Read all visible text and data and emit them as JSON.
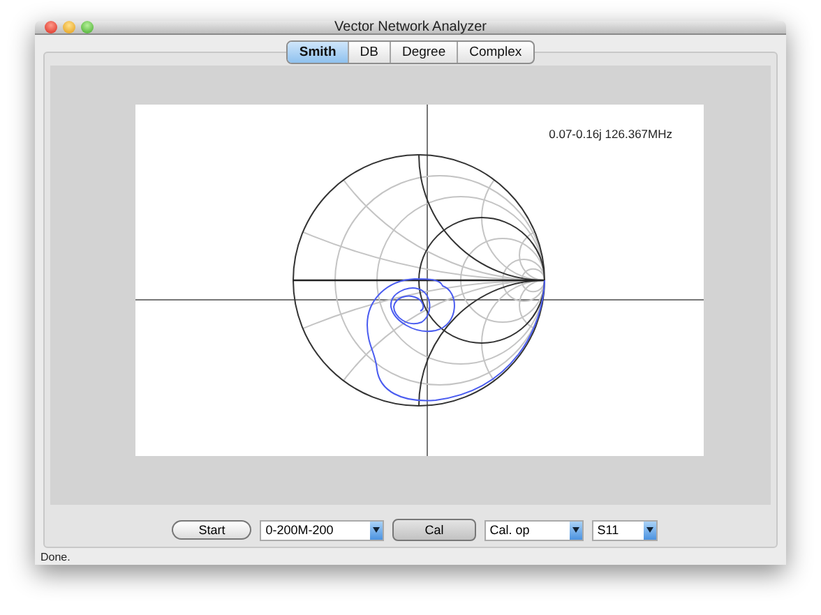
{
  "window": {
    "title": "Vector Network Analyzer"
  },
  "tabs": [
    {
      "label": "Smith",
      "selected": true
    },
    {
      "label": "DB",
      "selected": false
    },
    {
      "label": "Degree",
      "selected": false
    },
    {
      "label": "Complex",
      "selected": false
    }
  ],
  "plot": {
    "readout": "0.07-0.16j 126.367MHz"
  },
  "controls": [
    {
      "kind": "button",
      "label": "Start"
    },
    {
      "kind": "dropdown",
      "value": "0-200M-200"
    },
    {
      "kind": "button",
      "label": "Cal"
    },
    {
      "kind": "dropdown",
      "value": "Cal. op"
    },
    {
      "kind": "dropdown",
      "value": "S11"
    }
  ],
  "status_bar": {
    "text": "Done."
  }
}
